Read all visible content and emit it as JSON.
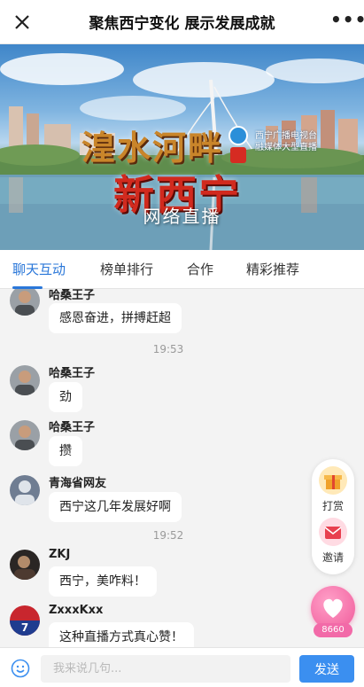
{
  "header": {
    "title": "聚焦西宁变化 展示发展成就",
    "more": "•••"
  },
  "banner": {
    "line1": "湟水河畔",
    "line2": "新西宁",
    "live_label": "网络直播",
    "station_name": "西宁广播电视台",
    "station_sub": "融媒体大型直播"
  },
  "tabs": [
    {
      "label": "聊天互动",
      "active": true
    },
    {
      "label": "榜单排行",
      "active": false
    },
    {
      "label": "合作",
      "active": false
    },
    {
      "label": "精彩推荐",
      "active": false
    }
  ],
  "chat": {
    "messages": [
      {
        "nick": "哈桑王子",
        "text": "感恩奋进，拼搏赶超",
        "avatar": "man-avatar"
      },
      {
        "time": "19:53"
      },
      {
        "nick": "哈桑王子",
        "text": "劲",
        "avatar": "man-avatar"
      },
      {
        "nick": "哈桑王子",
        "text": "攒",
        "avatar": "man-avatar"
      },
      {
        "nick": "青海省网友",
        "text": "西宁这几年发展好啊",
        "avatar": "default-avatar"
      },
      {
        "time": "19:52"
      },
      {
        "nick": "ZKJ",
        "text": "西宁，美咋料！",
        "avatar": "dark-avatar"
      },
      {
        "nick": "ZxxxKxx",
        "text": "这种直播方式真心赞！",
        "avatar": "jersey-avatar"
      }
    ]
  },
  "side_panel": {
    "reward_label": "打赏",
    "invite_label": "邀请",
    "like_count": "8660"
  },
  "input_bar": {
    "placeholder": "我来说几句...",
    "send_label": "发送"
  },
  "colors": {
    "accent": "#2a77d9",
    "send": "#3b8ff0",
    "like": "#f05a9a"
  }
}
